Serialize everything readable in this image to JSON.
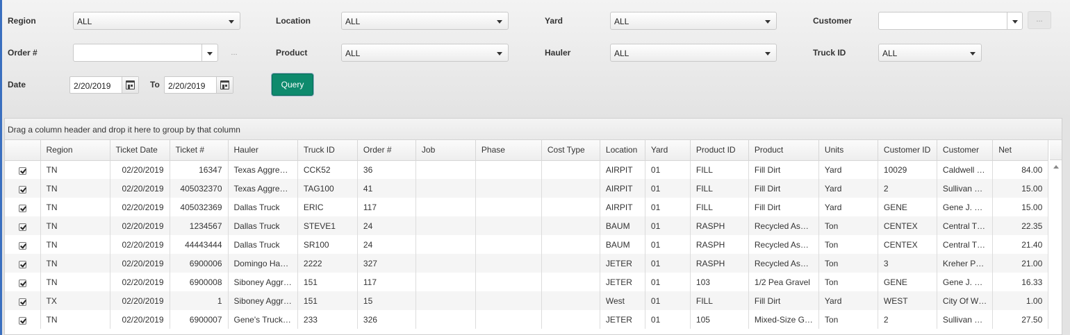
{
  "filters": {
    "region": {
      "label": "Region",
      "value": "ALL"
    },
    "location": {
      "label": "Location",
      "value": "ALL"
    },
    "yard": {
      "label": "Yard",
      "value": "ALL"
    },
    "customer": {
      "label": "Customer",
      "value": "",
      "ellipsis": "..."
    },
    "order": {
      "label": "Order #",
      "value": "",
      "ellipsis": "..."
    },
    "product": {
      "label": "Product",
      "value": "ALL"
    },
    "hauler": {
      "label": "Hauler",
      "value": "ALL"
    },
    "truck_id": {
      "label": "Truck ID",
      "value": "ALL"
    },
    "date": {
      "label": "Date",
      "from": "2/20/2019",
      "to_label": "To",
      "to": "2/20/2019"
    },
    "query_label": "Query"
  },
  "grid": {
    "group_hint": "Drag a column header and drop it here to group by that column",
    "columns": [
      "",
      "Region",
      "Ticket Date",
      "Ticket #",
      "Hauler",
      "Truck ID",
      "Order #",
      "Job",
      "Phase",
      "Cost Type",
      "Location",
      "Yard",
      "Product ID",
      "Product",
      "Units",
      "Customer ID",
      "Customer",
      "Net"
    ],
    "rows": [
      {
        "region": "TN",
        "ticket_date": "02/20/2019",
        "ticket": "16347",
        "hauler": "Texas Aggre…",
        "truck": "CCK52",
        "order": "36",
        "job": "",
        "phase": "",
        "cost_type": "",
        "location": "AIRPIT",
        "yard": "01",
        "product_id": "FILL",
        "product": "Fill Dirt",
        "units": "Yard",
        "customer_id": "10029",
        "customer": "Caldwell …",
        "net": "84.00"
      },
      {
        "region": "TN",
        "ticket_date": "02/20/2019",
        "ticket": "405032370",
        "hauler": "Texas Aggre…",
        "truck": "TAG100",
        "order": "41",
        "job": "",
        "phase": "",
        "cost_type": "",
        "location": "AIRPIT",
        "yard": "01",
        "product_id": "FILL",
        "product": "Fill Dirt",
        "units": "Yard",
        "customer_id": "2",
        "customer": "Sullivan …",
        "net": "15.00"
      },
      {
        "region": "TN",
        "ticket_date": "02/20/2019",
        "ticket": "405032369",
        "hauler": "Dallas Truck",
        "truck": "ERIC",
        "order": "117",
        "job": "",
        "phase": "",
        "cost_type": "",
        "location": "AIRPIT",
        "yard": "01",
        "product_id": "FILL",
        "product": "Fill Dirt",
        "units": "Yard",
        "customer_id": "GENE",
        "customer": "Gene J. …",
        "net": "15.00"
      },
      {
        "region": "TN",
        "ticket_date": "02/20/2019",
        "ticket": "1234567",
        "hauler": "Dallas Truck",
        "truck": "STEVE1",
        "order": "24",
        "job": "",
        "phase": "",
        "cost_type": "",
        "location": "BAUM",
        "yard": "01",
        "product_id": "RASPH",
        "product": "Recycled As…",
        "units": "Ton",
        "customer_id": "CENTEX",
        "customer": "Central T…",
        "net": "22.35"
      },
      {
        "region": "TN",
        "ticket_date": "02/20/2019",
        "ticket": "44443444",
        "hauler": "Dallas Truck",
        "truck": "SR100",
        "order": "24",
        "job": "",
        "phase": "",
        "cost_type": "",
        "location": "BAUM",
        "yard": "01",
        "product_id": "RASPH",
        "product": "Recycled As…",
        "units": "Ton",
        "customer_id": "CENTEX",
        "customer": "Central T…",
        "net": "21.40"
      },
      {
        "region": "TN",
        "ticket_date": "02/20/2019",
        "ticket": "6900006",
        "hauler": "Domingo Ha…",
        "truck": "2222",
        "order": "327",
        "job": "",
        "phase": "",
        "cost_type": "",
        "location": "JETER",
        "yard": "01",
        "product_id": "RASPH",
        "product": "Recycled As…",
        "units": "Ton",
        "customer_id": "3",
        "customer": "Kreher P…",
        "net": "21.00"
      },
      {
        "region": "TN",
        "ticket_date": "02/20/2019",
        "ticket": "6900008",
        "hauler": "Siboney Aggr…",
        "truck": "151",
        "order": "117",
        "job": "",
        "phase": "",
        "cost_type": "",
        "location": "JETER",
        "yard": "01",
        "product_id": "103",
        "product": "1/2 Pea Gravel",
        "units": "Ton",
        "customer_id": "GENE",
        "customer": "Gene J. …",
        "net": "16.33"
      },
      {
        "region": "TX",
        "ticket_date": "02/20/2019",
        "ticket": "1",
        "hauler": "Siboney Aggr…",
        "truck": "151",
        "order": "15",
        "job": "",
        "phase": "",
        "cost_type": "",
        "location": "West",
        "yard": "01",
        "product_id": "FILL",
        "product": "Fill Dirt",
        "units": "Yard",
        "customer_id": "WEST",
        "customer": "City Of W…",
        "net": "1.00"
      },
      {
        "region": "TN",
        "ticket_date": "02/20/2019",
        "ticket": "6900007",
        "hauler": "Gene's Truck…",
        "truck": "233",
        "order": "326",
        "job": "",
        "phase": "",
        "cost_type": "",
        "location": "JETER",
        "yard": "01",
        "product_id": "105",
        "product": "Mixed-Size G…",
        "units": "Ton",
        "customer_id": "2",
        "customer": "Sullivan …",
        "net": "27.50"
      }
    ]
  },
  "colors": {
    "query_button": "#0e8a6d",
    "window_edge": "#3a6fbf"
  }
}
